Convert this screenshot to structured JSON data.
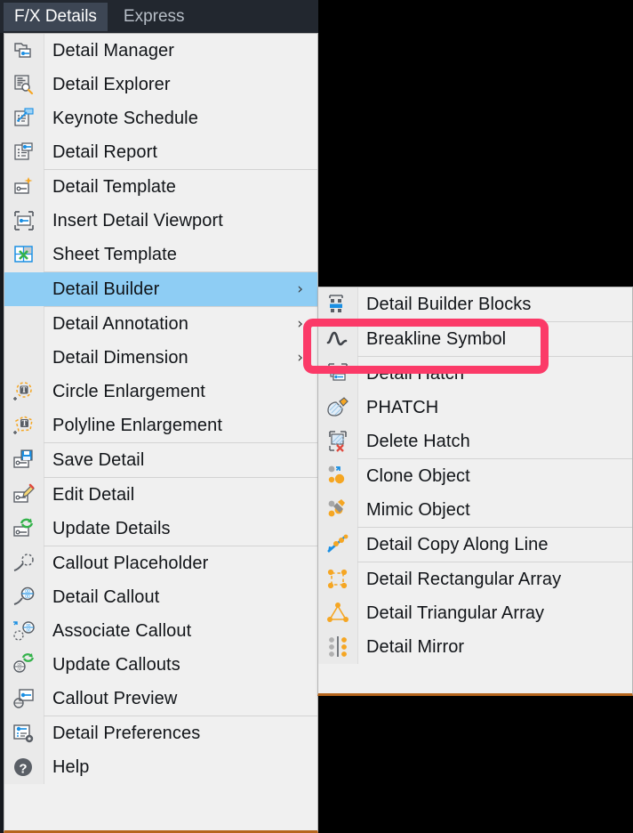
{
  "menubar": {
    "items": [
      {
        "label": "F/X Details",
        "active": true
      },
      {
        "label": "Express",
        "active": false
      }
    ]
  },
  "colors": {
    "menubar_bg": "#22272f",
    "menubar_active_bg": "#3d4654",
    "menu_bg": "#f0f0f0",
    "menu_gutter": "#eaeaea",
    "row_highlight": "#8ecdf4",
    "annotation_pink": "#fb3a68",
    "menu_bottom_border": "#b5651d",
    "canvas_black": "#000000"
  },
  "left_menu": {
    "title": "F/X Details",
    "items": [
      {
        "label": "Detail Manager",
        "icon": "detail-manager-icon",
        "submenu": false,
        "highlighted": false
      },
      {
        "label": "Detail Explorer",
        "icon": "detail-explorer-icon",
        "submenu": false,
        "highlighted": false
      },
      {
        "label": "Keynote Schedule",
        "icon": "keynote-schedule-icon",
        "submenu": false,
        "highlighted": false
      },
      {
        "label": "Detail Report",
        "icon": "detail-report-icon",
        "submenu": false,
        "highlighted": false,
        "sep_after": true
      },
      {
        "label": "Detail Template",
        "icon": "detail-template-icon",
        "submenu": false,
        "highlighted": false
      },
      {
        "label": "Insert Detail Viewport",
        "icon": "insert-detail-viewport-icon",
        "submenu": false,
        "highlighted": false
      },
      {
        "label": "Sheet Template",
        "icon": "sheet-template-icon",
        "submenu": false,
        "highlighted": false,
        "sep_after": true
      },
      {
        "label": "Detail Builder",
        "icon": "none",
        "submenu": true,
        "highlighted": true,
        "sep_after": true
      },
      {
        "label": "Detail Annotation",
        "icon": "none",
        "submenu": true,
        "highlighted": false
      },
      {
        "label": "Detail Dimension",
        "icon": "none",
        "submenu": true,
        "highlighted": false
      },
      {
        "label": "Circle Enlargement",
        "icon": "circle-enlargement-icon",
        "submenu": false,
        "highlighted": false
      },
      {
        "label": "Polyline Enlargement",
        "icon": "polyline-enlargement-icon",
        "submenu": false,
        "highlighted": false,
        "sep_after": true
      },
      {
        "label": "Save Detail",
        "icon": "save-detail-icon",
        "submenu": false,
        "highlighted": false,
        "sep_after": true
      },
      {
        "label": "Edit Detail",
        "icon": "edit-detail-icon",
        "submenu": false,
        "highlighted": false
      },
      {
        "label": "Update Details",
        "icon": "update-details-icon",
        "submenu": false,
        "highlighted": false,
        "sep_after": true
      },
      {
        "label": "Callout Placeholder",
        "icon": "callout-placeholder-icon",
        "submenu": false,
        "highlighted": false
      },
      {
        "label": "Detail Callout",
        "icon": "detail-callout-icon",
        "submenu": false,
        "highlighted": false
      },
      {
        "label": "Associate Callout",
        "icon": "associate-callout-icon",
        "submenu": false,
        "highlighted": false
      },
      {
        "label": "Update Callouts",
        "icon": "update-callouts-icon",
        "submenu": false,
        "highlighted": false
      },
      {
        "label": "Callout Preview",
        "icon": "callout-preview-icon",
        "submenu": false,
        "highlighted": false,
        "sep_after": true
      },
      {
        "label": "Detail Preferences",
        "icon": "detail-preferences-icon",
        "submenu": false,
        "highlighted": false
      },
      {
        "label": "Help",
        "icon": "help-icon",
        "submenu": false,
        "highlighted": false
      }
    ]
  },
  "submenu": {
    "parent": "Detail Builder",
    "items": [
      {
        "label": "Detail Builder Blocks",
        "icon": "detail-builder-blocks-icon",
        "sep_after": true,
        "annotated": false
      },
      {
        "label": "Breakline Symbol",
        "icon": "breakline-symbol-icon",
        "sep_after": true,
        "annotated": true
      },
      {
        "label": "Detail Hatch",
        "icon": "detail-hatch-icon",
        "sep_after": false,
        "annotated": false
      },
      {
        "label": "PHATCH",
        "icon": "phatch-icon",
        "sep_after": false,
        "annotated": false
      },
      {
        "label": "Delete Hatch",
        "icon": "delete-hatch-icon",
        "sep_after": true,
        "annotated": false
      },
      {
        "label": "Clone Object",
        "icon": "clone-object-icon",
        "sep_after": false,
        "annotated": false
      },
      {
        "label": "Mimic Object",
        "icon": "mimic-object-icon",
        "sep_after": true,
        "annotated": false
      },
      {
        "label": "Detail Copy Along Line",
        "icon": "detail-copy-along-line-icon",
        "sep_after": true,
        "annotated": false
      },
      {
        "label": "Detail Rectangular Array",
        "icon": "detail-rectangular-array-icon",
        "sep_after": false,
        "annotated": false
      },
      {
        "label": "Detail Triangular Array",
        "icon": "detail-triangular-array-icon",
        "sep_after": false,
        "annotated": false
      },
      {
        "label": "Detail Mirror",
        "icon": "detail-mirror-icon",
        "sep_after": false,
        "annotated": false
      }
    ]
  },
  "annotation": {
    "target": "Breakline Symbol",
    "shape": "rounded-rectangle-outline",
    "color": "#fb3a68"
  }
}
